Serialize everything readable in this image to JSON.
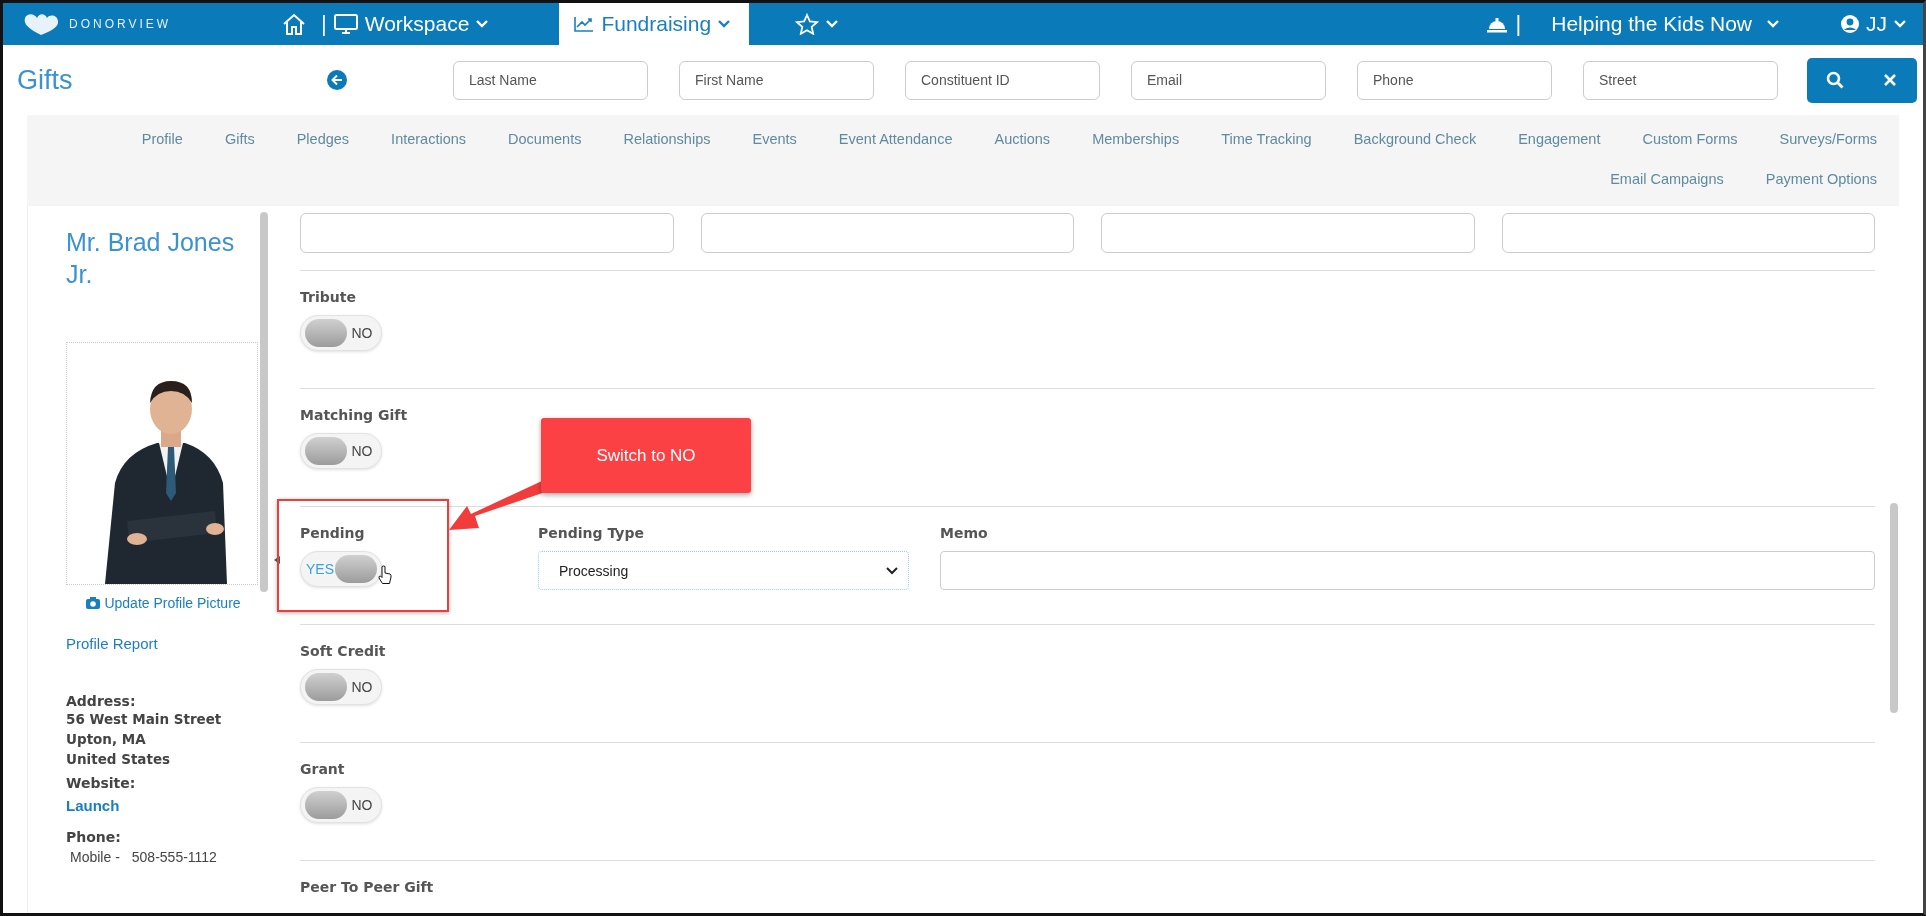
{
  "top_nav": {
    "brand": "DONORVIEW",
    "home_separator": "|",
    "menus": [
      {
        "kind": "workspace",
        "label": "Workspace",
        "selected": false
      },
      {
        "kind": "fundraising",
        "label": "Fundraising",
        "selected": true
      },
      {
        "kind": "favorites",
        "selected": false
      }
    ],
    "bell_separator": "|",
    "organization": "Helping the Kids Now",
    "user": "JJ"
  },
  "page_title": "Gifts",
  "search_fields": [
    {
      "placeholder": "Last Name"
    },
    {
      "placeholder": "First Name"
    },
    {
      "placeholder": "Constituent ID"
    },
    {
      "placeholder": "Email"
    },
    {
      "placeholder": "Phone"
    },
    {
      "placeholder": "Street"
    }
  ],
  "record_tabs": [
    {
      "label": "Profile",
      "selected": false
    },
    {
      "label": "Gifts",
      "selected": false
    },
    {
      "label": "Pledges",
      "selected": false
    },
    {
      "label": "Interactions",
      "selected": false
    },
    {
      "label": "Documents",
      "selected": false
    },
    {
      "label": "Relationships",
      "selected": false
    },
    {
      "label": "Events",
      "selected": false
    },
    {
      "label": "Event Attendance",
      "selected": false
    },
    {
      "label": "Auctions",
      "selected": false
    },
    {
      "label": "Memberships",
      "selected": false
    },
    {
      "label": "Time Tracking",
      "selected": false
    },
    {
      "label": "Background Check",
      "selected": false
    },
    {
      "label": "Engagement",
      "selected": false
    },
    {
      "label": "Custom Forms",
      "selected": false
    },
    {
      "label": "Surveys/Forms",
      "selected": false
    },
    {
      "label": "Email Campaigns",
      "selected": false
    },
    {
      "label": "Payment Options",
      "selected": false
    }
  ],
  "profile": {
    "name": "Mr. Brad Jones Jr.",
    "photo": {
      "kind": "picture"
    },
    "update_picture": "Update Profile Picture",
    "report_link": "Profile Report",
    "address_label": "Address:",
    "address_lines": [
      "56 West Main Street",
      "Upton, MA",
      "United States"
    ],
    "website_label": "Website:",
    "website_link": "Launch",
    "phone_label": "Phone:",
    "phones": [
      {
        "type": "Mobile -",
        "number": "508-555-1112"
      }
    ]
  },
  "form": {
    "top_fields": [
      {
        "kind": "text"
      },
      {
        "kind": "text"
      },
      {
        "kind": "text"
      },
      {
        "kind": "text"
      }
    ],
    "rows": [
      {
        "label": "Tribute",
        "highlighted": false,
        "toggle": {
          "on": false,
          "text": "NO"
        }
      },
      {
        "label": "Matching Gift",
        "highlighted": false,
        "toggle": {
          "on": false,
          "text": "NO"
        }
      },
      {
        "label": "Pending",
        "highlighted": true,
        "toggle": {
          "on": true,
          "text": "YES"
        },
        "extras": [
          {
            "kind": "select",
            "label": "Pending Type",
            "value": "Processing"
          },
          {
            "kind": "text",
            "label": "Memo"
          }
        ]
      },
      {
        "label": "Soft Credit",
        "highlighted": false,
        "toggle": {
          "on": false,
          "text": "NO"
        }
      },
      {
        "label": "Grant",
        "highlighted": false,
        "toggle": {
          "on": false,
          "text": "NO"
        }
      },
      {
        "label": "Peer To Peer Gift",
        "highlighted": false
      }
    ]
  },
  "callout": {
    "text": "Switch to NO"
  }
}
